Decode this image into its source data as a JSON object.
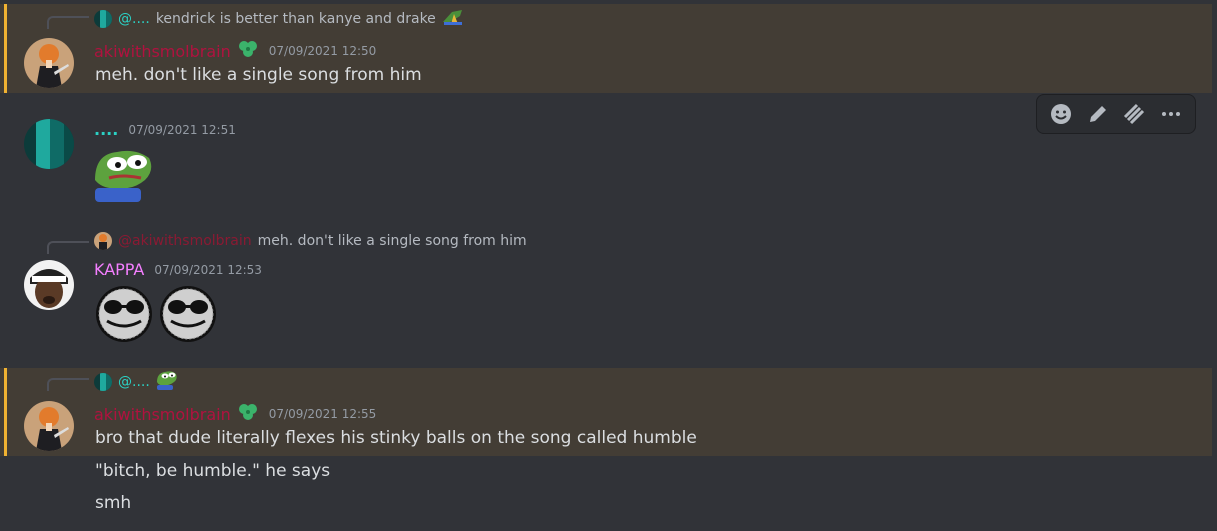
{
  "messages": [
    {
      "reply": {
        "mention": "@....",
        "text": "kendrick is better than kanye and drake",
        "emoji_icon": "crocodile-emoji-icon"
      },
      "author": "akiwithsmolbrain",
      "author_color": "#b0123f",
      "badge_icon": "clover-icon",
      "timestamp": "07/09/2021 12:50",
      "lines": [
        "meh. don't like a single song from him"
      ]
    },
    {
      "author": "....",
      "author_color": "#2bd1c4",
      "timestamp": "07/09/2021 12:51",
      "attachment_icon": "pepe-sad-emoji-icon"
    },
    {
      "reply": {
        "mention": "@akiwithsmolbrain",
        "text": "meh. don't like a single song from him"
      },
      "author": "KAPPA",
      "author_color": "#f47fff",
      "timestamp": "07/09/2021 12:53",
      "attachment_icons": [
        "sunglasses-face-emoji-icon",
        "sunglasses-face-emoji-icon"
      ]
    },
    {
      "reply": {
        "mention": "@....",
        "emoji_icon": "pepe-emoji-icon"
      },
      "author": "akiwithsmolbrain",
      "author_color": "#b0123f",
      "badge_icon": "clover-icon",
      "timestamp": "07/09/2021 12:55",
      "lines": [
        "bro that dude literally flexes his stinky balls on the song called humble",
        "\"bitch, be humble.\" he says",
        "smh"
      ]
    }
  ],
  "toolbar": {
    "buttons": [
      "add-reaction-icon",
      "edit-icon",
      "reply-thread-icon",
      "more-icon"
    ]
  },
  "colors": {
    "highlight_bg": "#433d35",
    "highlight_bar": "#f0b232",
    "app_bg": "#313338"
  }
}
